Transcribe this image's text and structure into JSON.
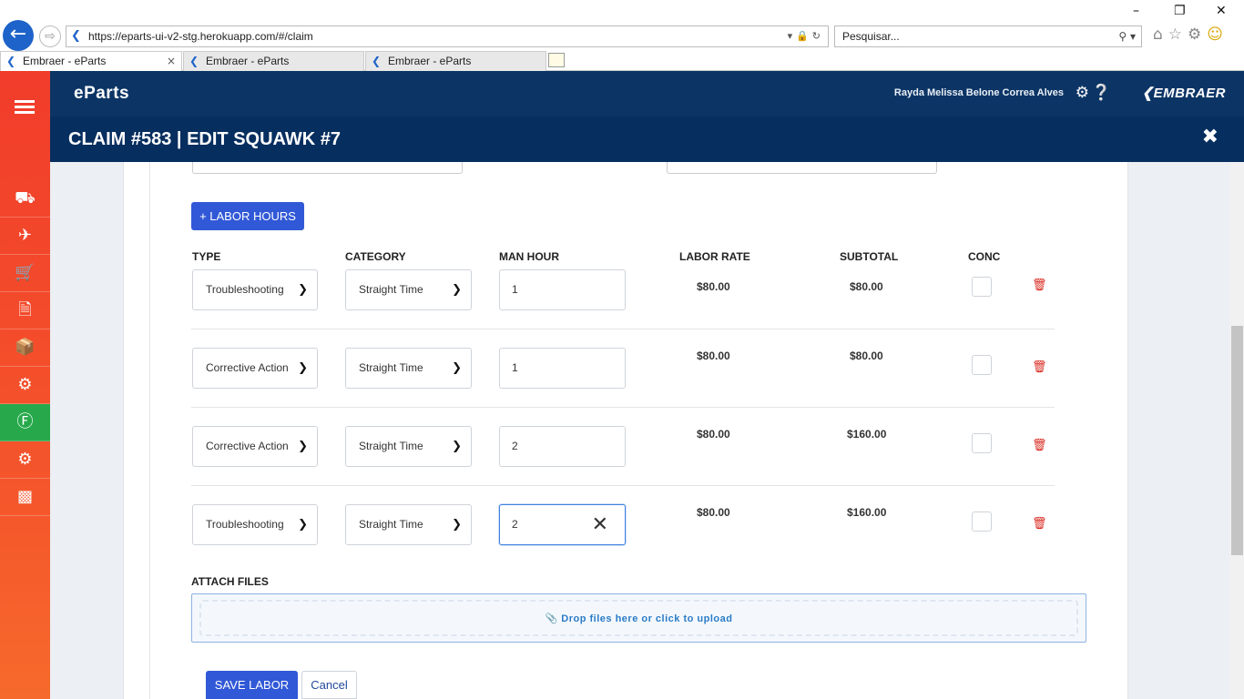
{
  "browser": {
    "url": "https://eparts-ui-v2-stg.herokuapp.com/#/claim",
    "search_placeholder": "Pesquisar...",
    "tabs": [
      {
        "label": "Embraer - eParts",
        "active": true
      },
      {
        "label": "Embraer - eParts",
        "active": false
      },
      {
        "label": "Embraer - eParts",
        "active": false
      }
    ]
  },
  "header": {
    "brand": "eParts",
    "user_name": "Rayda Melissa Belone Correa Alves",
    "logo": "EMBRAER"
  },
  "modal": {
    "title": "CLAIM #583 | EDIT SQUAWK #7"
  },
  "labor": {
    "add_button": "+ LABOR HOURS",
    "columns": {
      "type": "TYPE",
      "category": "CATEGORY",
      "man_hour": "MAN HOUR",
      "labor_rate": "LABOR RATE",
      "subtotal": "SUBTOTAL",
      "conc": "CONC"
    },
    "rows": [
      {
        "type": "Troubleshooting",
        "category": "Straight Time",
        "man_hour": "1",
        "labor_rate": "$80.00",
        "subtotal": "$80.00",
        "conc": false
      },
      {
        "type": "Corrective Action",
        "category": "Straight Time",
        "man_hour": "1",
        "labor_rate": "$80.00",
        "subtotal": "$80.00",
        "conc": false
      },
      {
        "type": "Corrective Action",
        "category": "Straight Time",
        "man_hour": "2",
        "labor_rate": "$80.00",
        "subtotal": "$160.00",
        "conc": false
      },
      {
        "type": "Troubleshooting",
        "category": "Straight Time",
        "man_hour": "2",
        "labor_rate": "$80.00",
        "subtotal": "$160.00",
        "conc": false
      }
    ]
  },
  "attach": {
    "label": "ATTACH FILES",
    "dropzone_text": "Drop files here or click to upload"
  },
  "actions": {
    "save": "SAVE LABOR",
    "cancel": "Cancel"
  },
  "colors": {
    "header_navy": "#0c3566",
    "modal_navy": "#062e5f",
    "sidebar_orange": "#f5572b",
    "sidebar_active_green": "#27a94b",
    "primary_blue": "#3158d6",
    "delete_red": "#d8281f"
  }
}
